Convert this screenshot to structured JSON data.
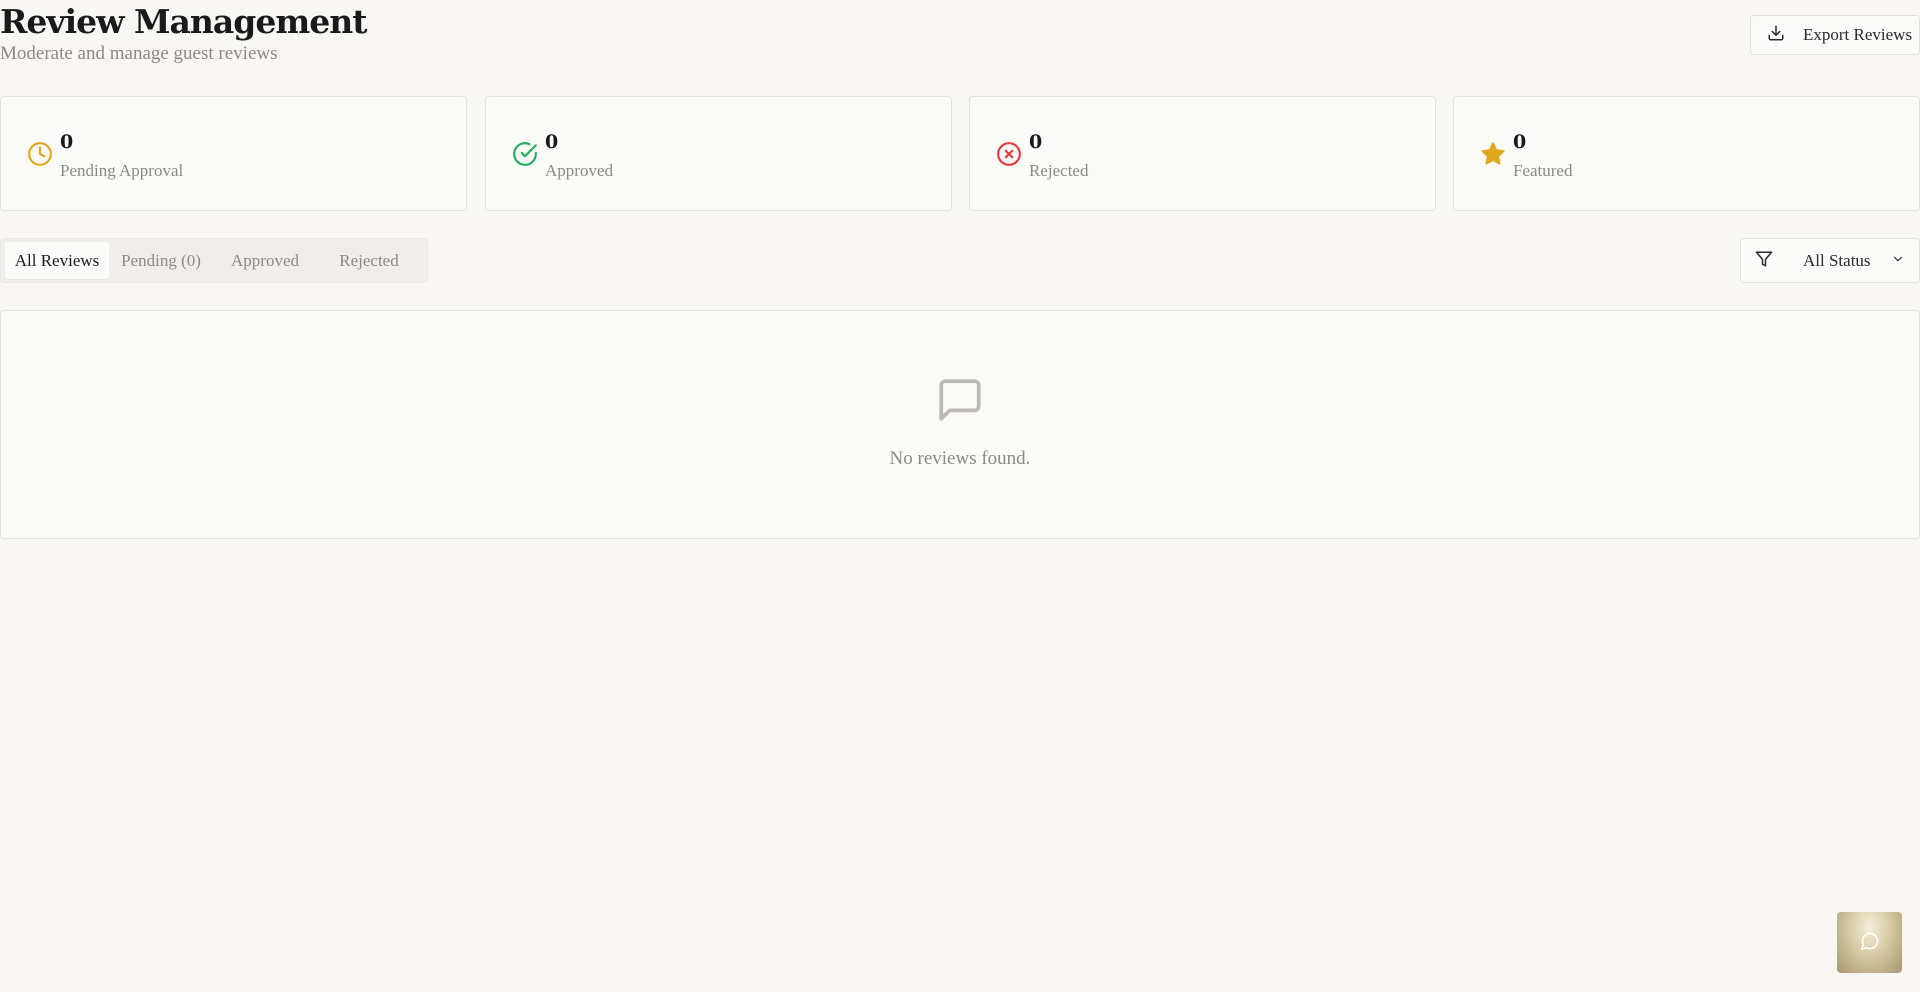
{
  "header": {
    "title": "Review Management",
    "subtitle": "Moderate and manage guest reviews",
    "export_label": "Export Reviews"
  },
  "stats": [
    {
      "value": "0",
      "label": "Pending Approval",
      "icon": "clock-icon",
      "color": "#e0a91b"
    },
    {
      "value": "0",
      "label": "Approved",
      "icon": "check-circle-icon",
      "color": "#27ae60"
    },
    {
      "value": "0",
      "label": "Rejected",
      "icon": "x-circle-icon",
      "color": "#e03c3c"
    },
    {
      "value": "0",
      "label": "Featured",
      "icon": "star-icon",
      "color": "#e0a91b"
    }
  ],
  "tabs": [
    {
      "label": "All Reviews",
      "active": true
    },
    {
      "label": "Pending (0)",
      "active": false
    },
    {
      "label": "Approved",
      "active": false
    },
    {
      "label": "Rejected",
      "active": false
    }
  ],
  "filter": {
    "selected": "All Status",
    "icon": "filter-icon"
  },
  "empty_state": {
    "icon": "message-square-icon",
    "text": "No reviews found."
  },
  "chat_button": {
    "icon": "chat-bubble-icon"
  }
}
